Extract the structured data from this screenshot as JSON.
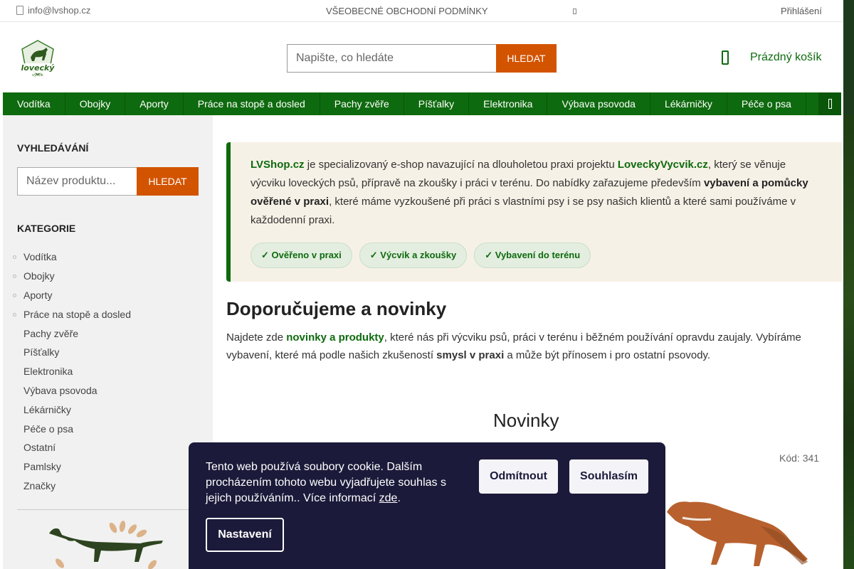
{
  "topbar": {
    "email": "info@lvshop.cz",
    "terms": "VŠEOBECNÉ OBCHODNÍ PODMÍNKY",
    "login": "Přihlášení"
  },
  "header": {
    "search_placeholder": "Napište, co hledáte",
    "search_button": "HLEDAT",
    "cart_label": "Prázdný košík"
  },
  "nav": {
    "items": [
      "Vodítka",
      "Obojky",
      "Aporty",
      "Práce na stopě a dosled",
      "Pachy zvěře",
      "Píšťalky",
      "Elektronika",
      "Výbava psovoda",
      "Lékárničky",
      "Péče o psa"
    ]
  },
  "sidebar": {
    "search_heading": "VYHLEDÁVÁNÍ",
    "search_placeholder": "Název produktu...",
    "search_button": "HLEDAT",
    "categories_heading": "KATEGORIE",
    "categories": [
      {
        "label": "Vodítka",
        "bullet": true
      },
      {
        "label": "Obojky",
        "bullet": true
      },
      {
        "label": "Aporty",
        "bullet": true
      },
      {
        "label": "Práce na stopě a dosled",
        "bullet": true
      },
      {
        "label": "Pachy zvěře",
        "bullet": false
      },
      {
        "label": "Píšťalky",
        "bullet": false
      },
      {
        "label": "Elektronika",
        "bullet": false
      },
      {
        "label": "Výbava psovoda",
        "bullet": false
      },
      {
        "label": "Lékárničky",
        "bullet": false
      },
      {
        "label": "Péče o psa",
        "bullet": false
      },
      {
        "label": "Ostatní",
        "bullet": false
      },
      {
        "label": "Pamlsky",
        "bullet": false
      },
      {
        "label": "Značky",
        "bullet": false
      }
    ]
  },
  "intro": {
    "p1_link": "LVShop.cz",
    "p1_a": " je specializovaný e-shop navazující na dlouholetou praxi projektu ",
    "p1_link2": "LoveckyVycvik.cz",
    "p1_b": ", který se věnuje výcviku loveckých psů, přípravě na zkoušky i práci v terénu. Do nabídky zařazujeme především ",
    "p1_bold": "vybavení a pomůcky ověřené v praxi",
    "p1_c": ", které máme vyzkoušené při práci s vlastními psy i se psy našich klientů a které sami používáme v každodenní praxi.",
    "badges": [
      "✓ Ověřeno v praxi",
      "✓ Výcvik a zkoušky",
      "✓ Vybavení do terénu"
    ]
  },
  "recommend": {
    "title": "Doporučujeme a novinky",
    "t_a": "Najdete zde ",
    "t_link": "novinky a produkty",
    "t_b": ", které nás při výcviku psů, práci v terénu i běžném používání opravdu zaujaly. Vybíráme vybavení, které má podle našich zkušeností ",
    "t_bold": "smysl v praxi",
    "t_c": " a může být přínosem i pro ostatní psovody."
  },
  "novinky": {
    "title": "Novinky",
    "code": "Kód: 341"
  },
  "cookie": {
    "text": "Tento web používá soubory cookie. Dalším procházením tohoto webu vyjadřujete souhlas s jejich používáním.. Více informací ",
    "link": "zde",
    "end": ".",
    "reject": "Odmítnout",
    "accept": "Souhlasím",
    "settings": "Nastavení"
  },
  "colors": {
    "brand_green": "#0e6a0e",
    "accent_orange": "#d35400",
    "cookie_bg": "#1b1a3a"
  }
}
